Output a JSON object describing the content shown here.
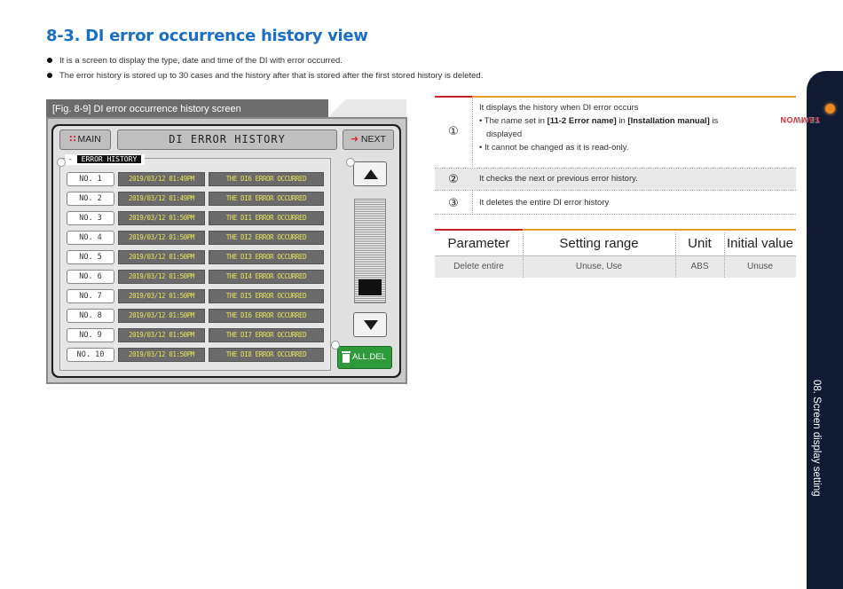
{
  "section_title": "8-3. DI error occurrence history view",
  "bullets": [
    "It is a screen to display the type, date and time of the DI with error occurred.",
    "The error history is stored up to 30 cases and the history after that is stored after the first stored history is deleted."
  ],
  "figure": {
    "caption": "[Fig. 8-9] DI error occurrence history screen",
    "screen": {
      "main_button": "MAIN",
      "title": "DI ERROR HISTORY",
      "next_button": "NEXT",
      "history_label": "ERROR HISTORY",
      "all_del_button": "ALL.DEL",
      "rows": [
        {
          "no": "NO.  1",
          "datetime": "2019/03/12 01:49PM",
          "message": "THE DI6 ERROR OCCURRED"
        },
        {
          "no": "NO.  2",
          "datetime": "2019/03/12 01:49PM",
          "message": "THE DI8 ERROR OCCURRED"
        },
        {
          "no": "NO.  3",
          "datetime": "2019/03/12 01:50PM",
          "message": "THE DI1 ERROR OCCURRED"
        },
        {
          "no": "NO.  4",
          "datetime": "2019/03/12 01:50PM",
          "message": "THE DI2 ERROR OCCURRED"
        },
        {
          "no": "NO.  5",
          "datetime": "2019/03/12 01:50PM",
          "message": "THE DI3 ERROR OCCURRED"
        },
        {
          "no": "NO.  6",
          "datetime": "2019/03/12 01:50PM",
          "message": "THE DI4 ERROR OCCURRED"
        },
        {
          "no": "NO.  7",
          "datetime": "2019/03/12 01:50PM",
          "message": "THE DI5 ERROR OCCURRED"
        },
        {
          "no": "NO.  8",
          "datetime": "2019/03/12 01:50PM",
          "message": "THE DI6 ERROR OCCURRED"
        },
        {
          "no": "NO.  9",
          "datetime": "2019/03/12 01:50PM",
          "message": "THE DI7 ERROR OCCURRED"
        },
        {
          "no": "NO. 10",
          "datetime": "2019/03/12 01:50PM",
          "message": "THE DI8 ERROR OCCURRED"
        }
      ],
      "scroll_position": 0.95
    }
  },
  "descriptions": [
    {
      "num": "①",
      "line1": "It displays the history when DI error occurs",
      "line2_pre": "• The name set in ",
      "line2_bold1": "[11-2 Error name]",
      "line2_mid": " in ",
      "line2_bold2": "[Installation manual]",
      "line2_post": " is",
      "line3": "displayed",
      "line4": "• It cannot be changed as it is read-only."
    },
    {
      "num": "②",
      "text": "It checks the next or previous error history."
    },
    {
      "num": "③",
      "text": "It deletes the entire DI error history"
    }
  ],
  "param_table": {
    "headers": [
      "Parameter",
      "Setting range",
      "Unit",
      "Initial value"
    ],
    "rows": [
      [
        "Delete entire",
        "Unuse, Use",
        "ABS",
        "Unuse"
      ]
    ]
  },
  "sidebar": {
    "brand_main": "SAMWON",
    "brand_sub": "TECH",
    "chapter": "08. Screen display setting"
  },
  "colors": {
    "title_blue": "#1a6fc4",
    "accent_red": "#d2282e",
    "accent_orange": "#e69a28",
    "sidebar_navy": "#111a33",
    "alldel_green": "#2f9a3a",
    "lcd_yellow": "#e6e35a"
  }
}
